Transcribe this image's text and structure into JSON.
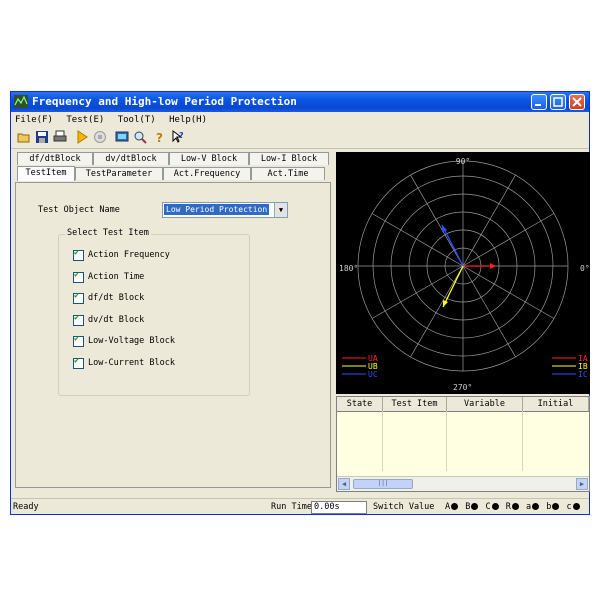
{
  "window": {
    "title": "Frequency and High-low Period Protection"
  },
  "menu": [
    "File(F)",
    "Test(E)",
    "Tool(T)",
    "Help(H)"
  ],
  "toolbar": {
    "icons": [
      "open-folder-icon",
      "save-icon",
      "print-icon",
      "run-icon",
      "stop-icon",
      "monitor-icon",
      "zoom-icon",
      "help-icon",
      "context-help-icon"
    ]
  },
  "tabs": {
    "row1": [
      "df/dtBlock",
      "dv/dtBlock",
      "Low-V Block",
      "Low-I Block"
    ],
    "row2": [
      "TestItem",
      "TestParameter",
      "Act.Frequency",
      "Act.Time"
    ],
    "active": "TestItem"
  },
  "test_object": {
    "label": "Test Object Name",
    "value": "Low Period Protection"
  },
  "select_group": {
    "title": "Select Test Item",
    "items": [
      {
        "label": "Action Frequency",
        "checked": true
      },
      {
        "label": "Action Time",
        "checked": true
      },
      {
        "label": "df/dt Block",
        "checked": true
      },
      {
        "label": "dv/dt Block",
        "checked": true
      },
      {
        "label": "Low-Voltage Block",
        "checked": true
      },
      {
        "label": "Low-Current Block",
        "checked": true
      }
    ]
  },
  "polar": {
    "angle_labels": {
      "top": "90°",
      "left": "180°",
      "right": "0°",
      "bottom": "270°"
    },
    "legend_left": [
      "UA",
      "UB",
      "UC"
    ],
    "legend_right": [
      "IA",
      "IB",
      "IC"
    ],
    "colors": {
      "a": "#ff2020",
      "b": "#ffff20",
      "c": "#3050ff",
      "grid": "#9a9a9a"
    }
  },
  "result_table": {
    "columns": [
      "State",
      "Test Item",
      "Variable",
      "Initial"
    ]
  },
  "status": {
    "ready": "Ready",
    "run_time_label": "Run Time",
    "run_time_value": "0.00s",
    "switch_label": "Switch Value",
    "switches": [
      "A",
      "B",
      "C",
      "R",
      "a",
      "b",
      "c"
    ]
  }
}
